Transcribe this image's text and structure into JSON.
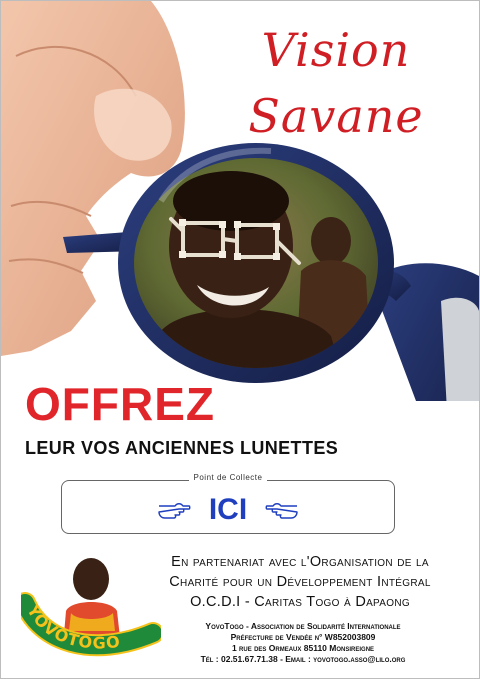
{
  "poster": {
    "title_line1": "Vision",
    "title_line2": "Savane",
    "headline": "OFFREZ",
    "subheadline": "LEUR VOS ANCIENNES LUNETTES",
    "collection_label": "Point de Collecte",
    "collection_place": "ICI",
    "partnership": [
      "En partenariat avec l'Organisation de la",
      "Charité pour un Développement Intégral",
      "O.C.D.I - Caritas Togo à Dapaong"
    ],
    "contact": [
      "YovoTogo - Association de Solidarité Internationale",
      "Préfecture de Vendée n° W852003809",
      "1 rue des Ormeaux 85110 Monsireigne",
      "Tél : 02.51.67.71.38 - Email : yovotogo.asso@lilo.org"
    ],
    "logo_text": "YOVOTOGO"
  },
  "colors": {
    "title_red": "#d01f24",
    "headline_red": "#e0262a",
    "ici_blue": "#1f3fbf",
    "frame_navy": "#1d2b5c"
  },
  "icons": [
    "pointing-hand-right-icon",
    "pointing-hand-left-icon"
  ]
}
